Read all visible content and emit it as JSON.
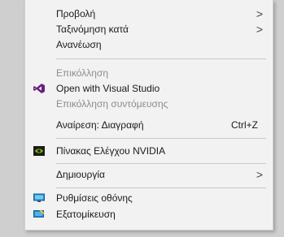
{
  "context_menu": {
    "items": [
      {
        "label": "Προβολή",
        "has_submenu": true
      },
      {
        "label": "Ταξινόμηση κατά",
        "has_submenu": true
      },
      {
        "label": "Ανανέωση"
      },
      {
        "label": "Επικόλληση",
        "disabled": true
      },
      {
        "label": "Open with Visual Studio",
        "icon": "visual-studio-icon"
      },
      {
        "label": "Επικόλληση συντόμευσης",
        "disabled": true
      },
      {
        "label": "Αναίρεση: Διαγραφή",
        "shortcut": "Ctrl+Z"
      },
      {
        "label": "Πίνακας Ελέγχου NVIDIA",
        "icon": "nvidia-icon"
      },
      {
        "label": "Δημιουργία",
        "has_submenu": true
      },
      {
        "label": "Ρυθμίσεις οθόνης",
        "icon": "display-settings-icon"
      },
      {
        "label": "Εξατομίκευση",
        "icon": "personalize-icon"
      }
    ],
    "arrow_glyph": ">",
    "colors": {
      "menu_background": "#f2f2f2",
      "text": "#1a1a1a",
      "disabled_text": "#8c8c8c",
      "visual_studio_purple": "#68217a",
      "nvidia_green": "#76b900",
      "windows_blue": "#1e90d0"
    }
  }
}
